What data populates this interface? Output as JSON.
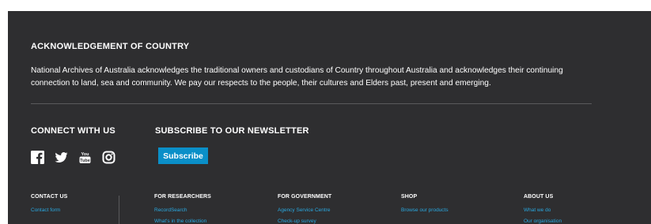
{
  "acknowledgement": {
    "title": "ACKNOWLEDGEMENT OF COUNTRY",
    "text": "National Archives of Australia acknowledges the traditional owners and custodians of Country throughout Australia and acknowledges their continuing connection to land, sea and community. We pay our respects to the people, their cultures and Elders past, present and emerging."
  },
  "connect": {
    "title": "CONNECT WITH US",
    "icons": [
      "facebook-icon",
      "twitter-icon",
      "youtube-icon",
      "instagram-icon"
    ]
  },
  "newsletter": {
    "title": "SUBSCRIBE TO OUR NEWSLETTER",
    "button_label": "Subscribe"
  },
  "columns": [
    {
      "heading": "CONTACT US",
      "links": [
        "Contact form"
      ]
    },
    {
      "heading": "FOR RESEARCHERS",
      "links": [
        "RecordSearch",
        "What's in the collection"
      ]
    },
    {
      "heading": "FOR GOVERNMENT",
      "links": [
        "Agency Service Centre",
        "Check-up survey"
      ]
    },
    {
      "heading": "SHOP",
      "links": [
        "Browse our products"
      ]
    },
    {
      "heading": "ABOUT US",
      "links": [
        "What we do",
        "Our organisation"
      ]
    }
  ],
  "colors": {
    "background": "#2e2e30",
    "accent": "#0a8fc8",
    "link": "#29a8e0",
    "divider": "#5a5a5c"
  }
}
